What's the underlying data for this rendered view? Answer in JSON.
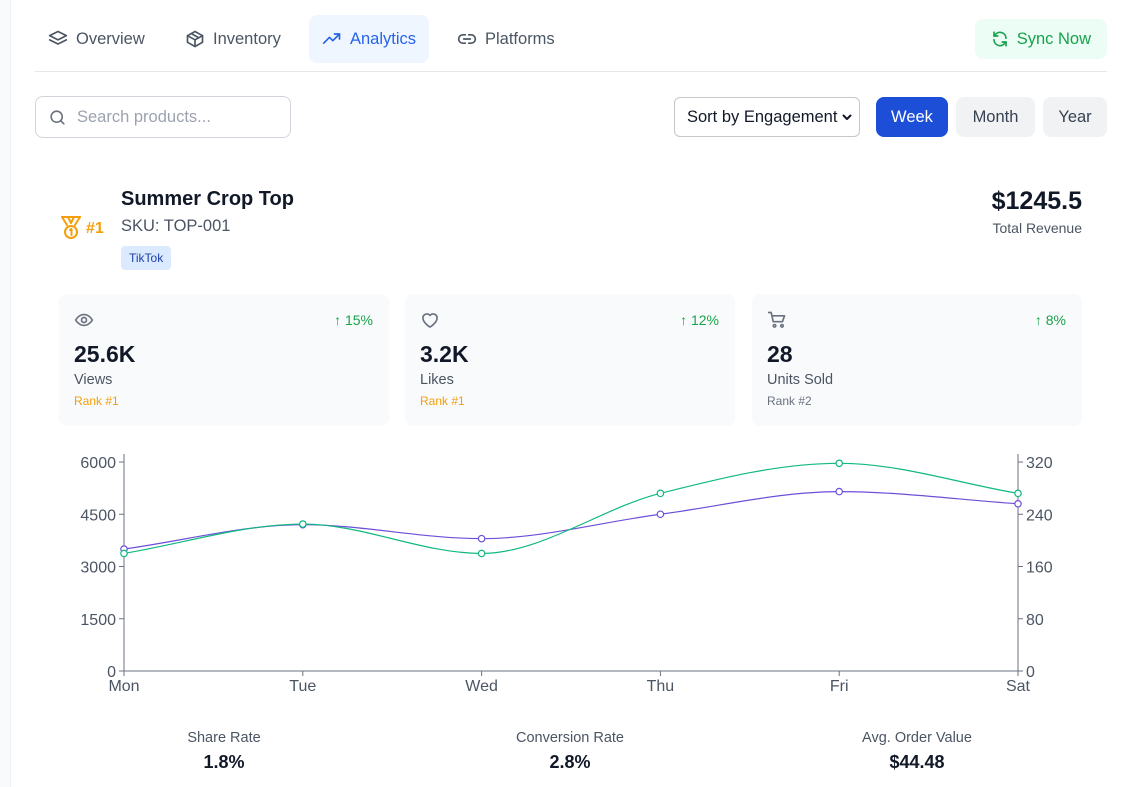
{
  "nav": {
    "tabs": [
      {
        "label": "Overview",
        "icon": "layers-icon"
      },
      {
        "label": "Inventory",
        "icon": "box-icon"
      },
      {
        "label": "Analytics",
        "icon": "trending-up-icon"
      },
      {
        "label": "Platforms",
        "icon": "link-icon"
      }
    ],
    "active_tab": "Analytics",
    "sync_label": "Sync Now"
  },
  "toolbar": {
    "search_placeholder": "Search products...",
    "sort_value": "Sort by Engagement",
    "periods": [
      "Week",
      "Month",
      "Year"
    ],
    "active_period": "Week"
  },
  "product": {
    "rank": "#1",
    "name": "Summer Crop Top",
    "sku": "SKU: TOP-001",
    "platform": "TikTok",
    "revenue": "$1245.5",
    "revenue_label": "Total Revenue"
  },
  "metrics": [
    {
      "icon": "eye-icon",
      "change": "↑ 15%",
      "value": "25.6K",
      "label": "Views",
      "rank": "Rank #1",
      "rank_color": "#f59e0b"
    },
    {
      "icon": "heart-icon",
      "change": "↑ 12%",
      "value": "3.2K",
      "label": "Likes",
      "rank": "Rank #1",
      "rank_color": "#f59e0b"
    },
    {
      "icon": "cart-icon",
      "change": "↑ 8%",
      "value": "28",
      "label": "Units Sold",
      "rank": "Rank #2",
      "rank_color": "#6b7280"
    }
  ],
  "chart_data": {
    "type": "line",
    "categories": [
      "Mon",
      "Tue",
      "Wed",
      "Thu",
      "Fri",
      "Sat"
    ],
    "left_axis": {
      "ticks": [
        0,
        1500,
        3000,
        4500,
        6000
      ],
      "ylim": [
        0,
        6000
      ]
    },
    "right_axis": {
      "ticks": [
        0,
        80,
        160,
        240,
        320
      ],
      "ylim": [
        0,
        320
      ]
    },
    "series": [
      {
        "axis": "left",
        "color": "#6d4fd8",
        "values": [
          3500,
          4200,
          3800,
          4500,
          5150,
          4800
        ]
      },
      {
        "axis": "right",
        "color": "#10b981",
        "values": [
          180,
          225,
          180,
          272,
          318,
          272
        ]
      }
    ],
    "grid": false,
    "legend": "none"
  },
  "stats": [
    {
      "label": "Share Rate",
      "value": "1.8%"
    },
    {
      "label": "Conversion Rate",
      "value": "2.8%"
    },
    {
      "label": "Avg. Order Value",
      "value": "$44.48"
    }
  ],
  "colors": {
    "accent": "#1d4ed8",
    "analytics_tab": "#2563eb",
    "sync": "#16a34a",
    "gold": "#f59e0b"
  }
}
